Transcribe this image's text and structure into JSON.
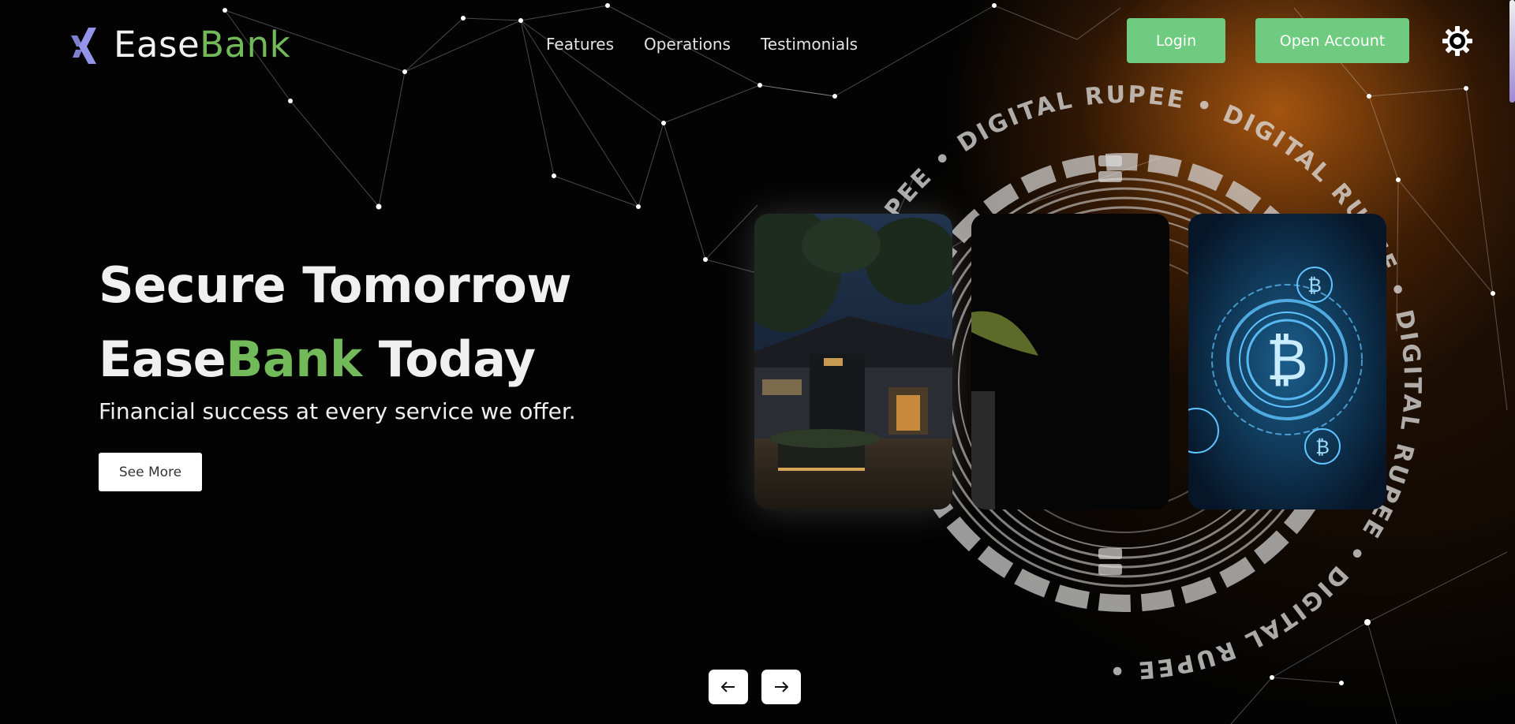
{
  "brand": {
    "name_part1": "Ease",
    "name_part2": "Bank",
    "accent_color": "#72b95a",
    "logo_icon": "x-logo-icon"
  },
  "nav": {
    "items": [
      "Features",
      "Operations",
      "Testimonials"
    ]
  },
  "header": {
    "login_label": "Login",
    "open_account_label": "Open Account",
    "settings_icon": "gear-icon"
  },
  "hero": {
    "title_line1": "Secure Tomorrow",
    "title_line2_part1": "Ease",
    "title_line2_part2": "Bank",
    "title_line2_part3": " Today",
    "subtitle": "Financial success at every service we offer.",
    "cta_label": "See More"
  },
  "coin_text": "DIGITAL RUPEE",
  "carousel": {
    "cards": [
      {
        "name": "building-night-image"
      },
      {
        "name": "dark-plant-image"
      },
      {
        "name": "bitcoin-circuit-image"
      }
    ],
    "prev_icon": "arrow-left-icon",
    "next_icon": "arrow-right-icon"
  }
}
